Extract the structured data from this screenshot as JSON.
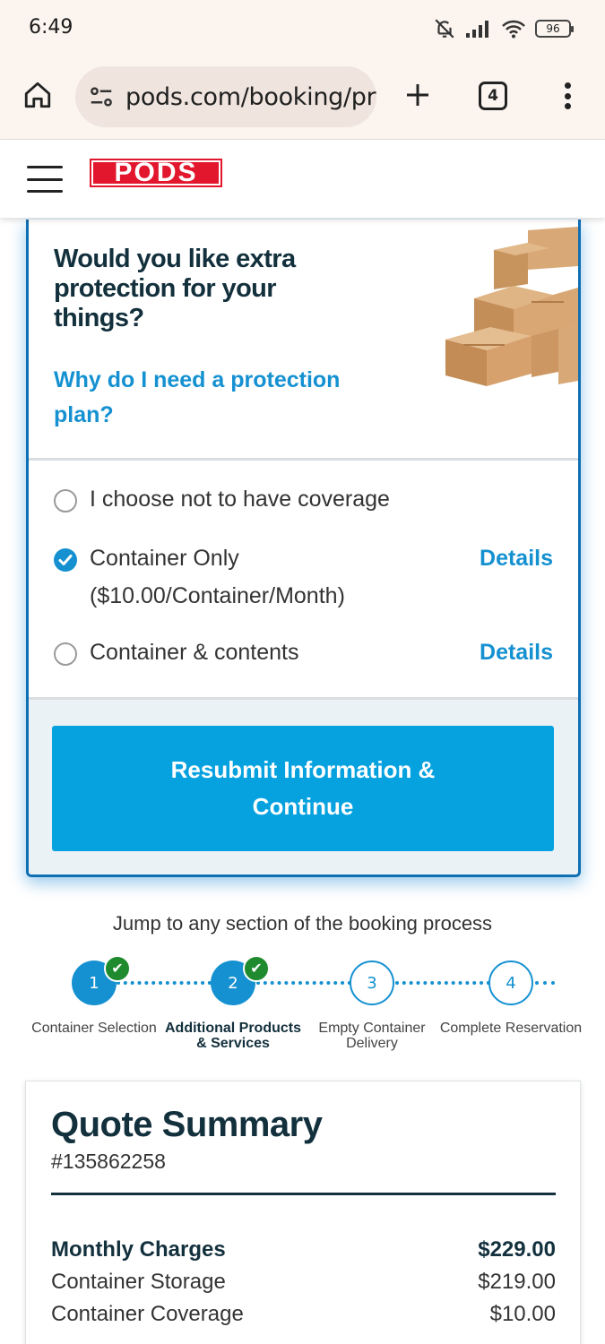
{
  "status_bar": {
    "time": "6:49",
    "battery": "96"
  },
  "browser": {
    "url": "pods.com/booking/protection",
    "tab_count": "4"
  },
  "site": {
    "logo_text": "PODS"
  },
  "protection": {
    "title": "Would you like extra protection for your things?",
    "why_link": "Why do I need a protection plan?",
    "options": [
      {
        "label": "I choose not to have coverage",
        "selected": false
      },
      {
        "label": "Container Only",
        "sublabel": "($10.00/Container/Month)",
        "selected": true,
        "details": "Details"
      },
      {
        "label": "Container & contents",
        "selected": false,
        "details": "Details"
      }
    ],
    "submit_label": "Resubmit Information & Continue"
  },
  "stepper": {
    "heading": "Jump to any section of the booking process",
    "steps": [
      {
        "number": "1",
        "label": "Container Selection",
        "completed": true
      },
      {
        "number": "2",
        "label": "Additional Products & Services",
        "completed": true,
        "active": true
      },
      {
        "number": "3",
        "label": "Empty Container Delivery",
        "completed": false
      },
      {
        "number": "4",
        "label": "Complete Reservation",
        "completed": false
      }
    ]
  },
  "quote": {
    "title": "Quote Summary",
    "number": "#135862258",
    "rows": [
      {
        "label": "Monthly Charges",
        "value": "$229.00"
      },
      {
        "label": "Container Storage",
        "value": "$219.00"
      },
      {
        "label": "Container Coverage",
        "value": "$10.00"
      }
    ]
  },
  "colors": {
    "accent": "#1591d1",
    "button": "#06a2e0",
    "brand_red": "#e2162d",
    "heading": "#13303d",
    "check_green": "#1f8a2e"
  }
}
